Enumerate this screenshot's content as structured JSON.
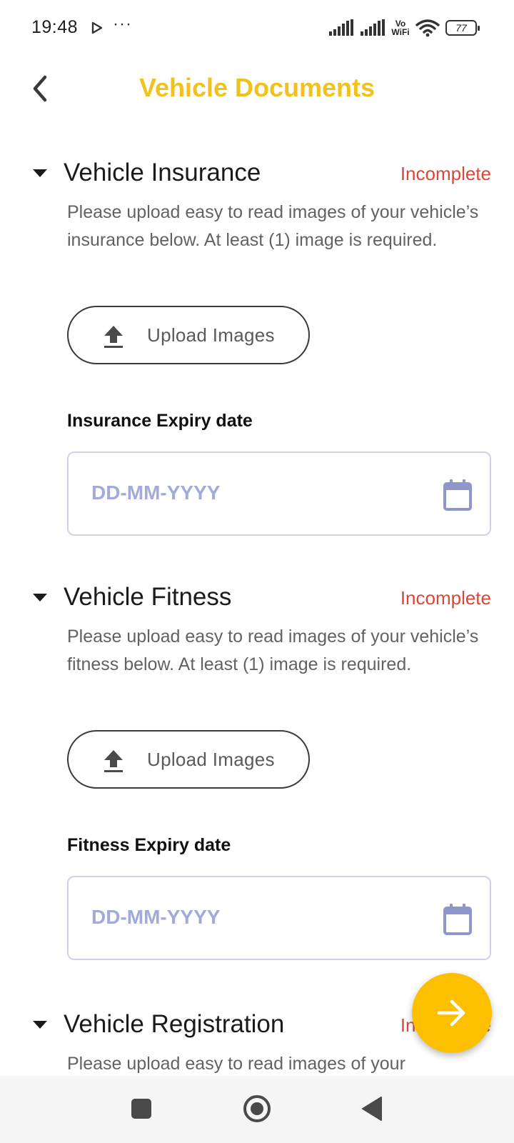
{
  "status_bar": {
    "time": "19:48",
    "dots": "···",
    "network": "Vo\nWiFi",
    "battery": "77"
  },
  "header": {
    "title": "Vehicle Documents",
    "title_color": "#f1c21b"
  },
  "sections": [
    {
      "title": "Vehicle Insurance",
      "status": "Incomplete",
      "description": "Please upload easy to read images of your vehicle’s insurance below. At least (1) image is required.",
      "upload_label": "Upload Images",
      "date_label": "Insurance Expiry date",
      "date_placeholder": "DD-MM-YYYY"
    },
    {
      "title": "Vehicle Fitness",
      "status": "Incomplete",
      "description": "Please upload easy to read images of your vehicle’s fitness below. At least (1) image is required.",
      "upload_label": "Upload Images",
      "date_label": "Fitness Expiry date",
      "date_placeholder": "DD-MM-YYYY"
    },
    {
      "title": "Vehicle Registration",
      "status": "Incomplete",
      "description": "Please upload easy to read images of your"
    }
  ],
  "colors": {
    "status_incomplete": "#d9473b",
    "fab": "#fdc000",
    "date_placeholder": "#a2abd8"
  },
  "icons": {
    "back": "chevron-left-icon",
    "caret": "caret-down-icon",
    "upload": "upload-icon",
    "calendar": "calendar-icon",
    "fab": "arrow-right-icon"
  }
}
